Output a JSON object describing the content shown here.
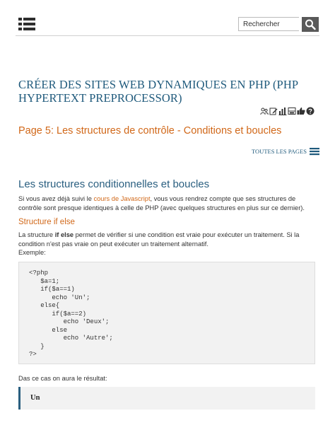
{
  "header": {
    "search_placeholder": "Rechercher"
  },
  "document": {
    "title": "Créer des sites web dynamiques en PHP (PHP Hypertext Preprocessor)",
    "page_label": "Page 5:",
    "page_title": "Les structures de contrôle - Conditions et boucles",
    "toc_link": "Toutes les pages",
    "section_title": "Les structures conditionnelles et boucles",
    "intro": {
      "before": "Si vous avez déjà suivi le ",
      "link": "cours de Javascript",
      "after": ", vous vous rendrez compte que ses structures de contrôle sont presque identiques à celle de PHP (avec quelques structures en plus sur ce dernier)."
    },
    "subsection_title": "Structure if else",
    "desc": {
      "before": "La structure ",
      "keyword": "if else",
      "after": " permet de vérifier si une condition est vraie pour exécuter un traitement. Si la condition n'est pas vraie on peut exécuter un traitement alternatif."
    },
    "example_label": "Exemple:",
    "code_lines": [
      "<?php",
      "   $a=1;",
      "   if($a==1)",
      "      echo 'Un';",
      "   else{",
      "      if($a==2)",
      "         echo 'Deux';",
      "      else",
      "         echo 'Autre';",
      "   }",
      "?>"
    ],
    "result_intro": "Das ce cas on aura le résultat:",
    "result_value": "Un"
  },
  "icons": [
    "menu-icon",
    "search-icon",
    "users-icon",
    "edit-icon",
    "chart-icon",
    "print-icon",
    "thumbs-up-icon",
    "help-icon",
    "list-icon"
  ],
  "colors": {
    "title_blue": "#1f5a7c",
    "accent_orange": "#d16819",
    "search_button": "#595959",
    "code_bg": "#f2f2f2"
  }
}
